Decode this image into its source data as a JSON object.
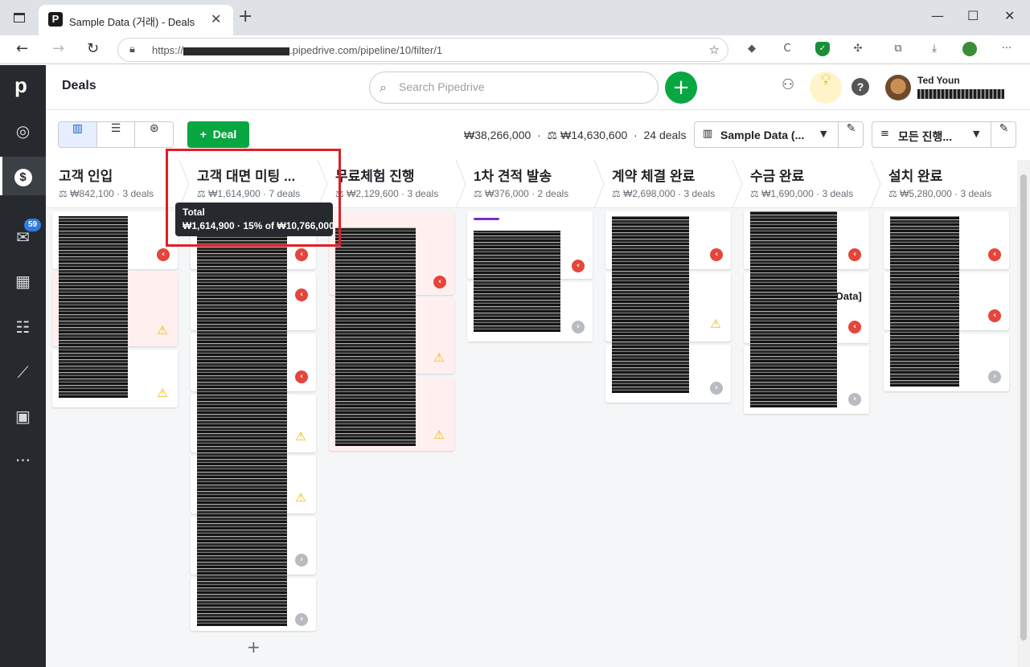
{
  "browser": {
    "tab_title": "Sample Data (거래) - Deals",
    "tab_favicon": "P",
    "close_glyph": "✕",
    "new_tab_glyph": "+",
    "url_prefix": "https://",
    "url_suffix": ".pipedrive.com/pipeline/10/filter/1",
    "window_controls": [
      "—",
      "☐",
      "✕"
    ]
  },
  "sidebar": {
    "logo": "p",
    "mail_badge": "59",
    "items": [
      {
        "icon": "target-icon",
        "glyph": "◎"
      },
      {
        "icon": "deals-icon",
        "glyph": "$"
      },
      {
        "icon": "mail-icon",
        "glyph": "✉"
      },
      {
        "icon": "calendar-icon",
        "glyph": "▦"
      },
      {
        "icon": "contacts-icon",
        "glyph": "☷"
      },
      {
        "icon": "insights-icon",
        "glyph": "⟋"
      },
      {
        "icon": "products-icon",
        "glyph": "▣"
      },
      {
        "icon": "more-icon",
        "glyph": "···"
      }
    ]
  },
  "header": {
    "title": "Deals",
    "search_placeholder": "Search Pipedrive",
    "user_name": "Ted Youn"
  },
  "toolbar": {
    "add_deal_label": "Deal",
    "summary_total": "₩38,266,000",
    "summary_weighted": "₩14,630,600",
    "summary_count": "24 deals",
    "pipeline_select": "Sample Data (...",
    "filter_select": "모든 진행..."
  },
  "stages": [
    {
      "name": "고객 인입",
      "amount": "₩842,100",
      "deals": "3 deals"
    },
    {
      "name": "고객 대면 미팅 ...",
      "amount": "₩1,614,900",
      "deals": "7 deals"
    },
    {
      "name": "무료체험 진행",
      "amount": "₩2,129,600",
      "deals": "3 deals"
    },
    {
      "name": "1차 견적 발송",
      "amount": "₩376,000",
      "deals": "2 deals"
    },
    {
      "name": "계약 체결 완료",
      "amount": "₩2,698,000",
      "deals": "3 deals"
    },
    {
      "name": "수금 완료",
      "amount": "₩1,690,000",
      "deals": "3 deals"
    },
    {
      "name": "설치 완료",
      "amount": "₩5,280,000",
      "deals": "3 deals"
    }
  ],
  "tooltip": {
    "title": "Total",
    "body": "₩1,614,900 · 15% of ₩10,766,000"
  },
  "card_labels": {
    "stage5_card2": "[Data]"
  },
  "colors": {
    "brand_green": "#08a742",
    "sidebar_bg": "#262a2e",
    "alert_red": "#e5453a",
    "warning_yellow": "#f2b400",
    "highlight_red": "#e01f26"
  }
}
